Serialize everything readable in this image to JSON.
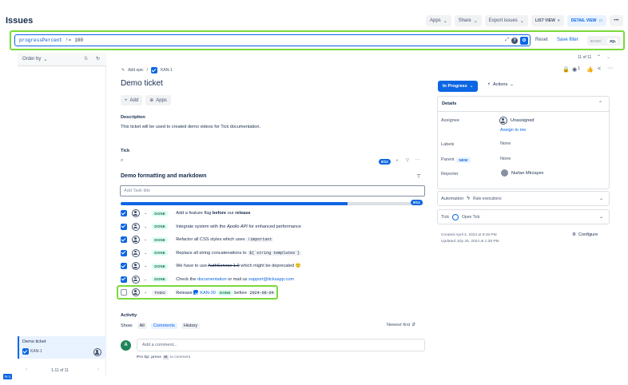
{
  "page": {
    "title": "Issues"
  },
  "header": {
    "apps": "Apps",
    "share": "Share",
    "export": "Export issues",
    "list_view": "LIST VIEW",
    "detail_view": "DETAIL VIEW",
    "more": "•••"
  },
  "search": {
    "query_key": "progressPercent",
    "query_op": "!=",
    "query_val": "100",
    "reset": "Reset",
    "save_filter": "Save filter",
    "basic": "BASIC",
    "jql": "JQL"
  },
  "sidebar": {
    "order_by": "Order by",
    "card_title": "Demo ticket",
    "card_key": "KAN-1",
    "pagination": "1-11 of 11",
    "edge_tag": "N-1"
  },
  "issue": {
    "counter": "11 of 11",
    "add_epic": "Add epic",
    "breadcrumb_key": "KAN-1",
    "title": "Demo ticket",
    "add_btn": "Add",
    "apps_btn": "Apps",
    "watch_count": "1",
    "description_label": "Description",
    "description_text": "This ticket will be used to created demo videos for Tick documentation.",
    "tick_label": "Tick",
    "tick_count": "9/12",
    "checklist_title": "Demo formatting and markdown",
    "add_task_placeholder": "Add Task title",
    "progress_label": "9/12",
    "progress_fraction": 0.75
  },
  "tasks": [
    {
      "status": "DONE",
      "parts": [
        {
          "t": "Add a feature flag "
        },
        {
          "t": "before",
          "b": true
        },
        {
          "t": " our "
        },
        {
          "t": "release",
          "b": true
        }
      ]
    },
    {
      "status": "DONE",
      "parts": [
        {
          "t": "Integrate system with the "
        },
        {
          "t": "Apollo API",
          "i": true
        },
        {
          "t": " for enhanced performance"
        }
      ]
    },
    {
      "status": "DONE",
      "parts": [
        {
          "t": "Refactor all CSS styles which uses "
        },
        {
          "t": "!important",
          "c": true
        }
      ]
    },
    {
      "status": "DONE",
      "parts": [
        {
          "t": "Replace all string concatenations to "
        },
        {
          "t": "${`string templates`}",
          "c": true
        }
      ]
    },
    {
      "status": "DONE",
      "parts": [
        {
          "t": "We have to use "
        },
        {
          "t": "AuthService 1.0",
          "s": true
        },
        {
          "t": " which might be deprecated 🙂"
        }
      ]
    },
    {
      "status": "DONE",
      "parts": [
        {
          "t": "Check the "
        },
        {
          "t": "documentation",
          "l": true
        },
        {
          "t": " or mail us "
        },
        {
          "t": "support@ticksapp.com",
          "l": true
        }
      ]
    },
    {
      "status": "TODO",
      "parts": [
        {
          "t": "Release "
        },
        {
          "t": "KAN-30",
          "k": true
        },
        {
          "t": " DONE",
          "d": true
        },
        {
          "t": " before "
        },
        {
          "t": "2024-08-04",
          "c": true
        }
      ]
    }
  ],
  "activity": {
    "label": "Activity",
    "show": "Show:",
    "all": "All",
    "comments": "Comments",
    "history": "History",
    "sort": "Newest first",
    "comment_placeholder": "Add a comment...",
    "avatar_letter": "A",
    "pro_tip": "Pro tip: press",
    "pro_tip_key": "M",
    "pro_tip_end": "to comment"
  },
  "right": {
    "status": "In Progress",
    "actions": "Actions",
    "details": "Details",
    "assignee_label": "Assignee",
    "assignee_value": "Unassigned",
    "assign_to_me": "Assign to me",
    "labels_label": "Labels",
    "labels_value": "None",
    "parent_label": "Parent",
    "parent_badge": "NEW",
    "parent_value": "None",
    "reporter_label": "Reporter",
    "reporter_value": "Nurlan Mirzayev",
    "automation_label": "Automation",
    "automation_value": "Rule executions",
    "tick_label": "Tick",
    "tick_open": "Open Tick",
    "created": "Created April 4, 2024 at 8:49 PM",
    "updated": "Updated July 25, 2024 at 1:38 PM",
    "configure": "Configure"
  },
  "colors": {
    "accent": "#0c66e4",
    "highlight": "#7bd93a",
    "done_bg": "#dcfff1",
    "done_fg": "#216e4e"
  }
}
